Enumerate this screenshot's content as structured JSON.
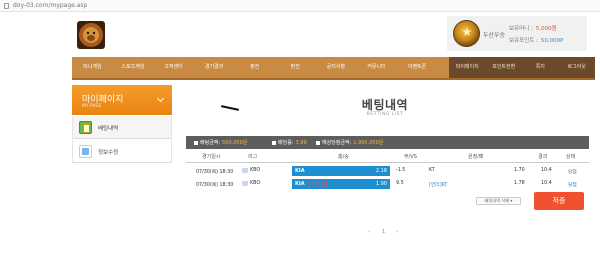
{
  "browser": {
    "url": "doy-03.com/mypage.asp"
  },
  "user_box": {
    "username": "두산우승",
    "money_label": "보유머니 :",
    "money_value": "5,000원",
    "point_label": "보유포인트 :",
    "point_value": "50,000P"
  },
  "nav": {
    "main": [
      "미니게임",
      "스포츠게임",
      "고객센터",
      "경기결과",
      "출전",
      "환전",
      "공지사항",
      "커뮤니티",
      "이벤트존"
    ],
    "sub": [
      "마이페이지",
      "포인트전환",
      "쪽지",
      "로그아웃"
    ]
  },
  "sidebar": {
    "title": "마이페이지",
    "subtitle": "MY PAGE",
    "items": [
      {
        "label": "베팅내역"
      },
      {
        "label": "정보수정"
      }
    ]
  },
  "page": {
    "title": "베팅내역",
    "subtitle": "BETTING LIST"
  },
  "summary": [
    {
      "label": "배팅금액:",
      "value": "500,000원"
    },
    {
      "label": "배당률:",
      "value": "3.99"
    },
    {
      "label": "예상당첨금액:",
      "value": "1,995,000원"
    }
  ],
  "table": {
    "headers": [
      "경기일시",
      "리그",
      "홈/승",
      "무/VS",
      "원정/패",
      "결과",
      "상태"
    ],
    "rows": [
      {
        "date": "07/30(목) 18:30",
        "league": "KBO",
        "home": "KIA",
        "home_note": "",
        "home_odds": "2.18",
        "vs": "-1.5",
        "away": "KT",
        "away_odds": "1.70",
        "score": "10:4",
        "status": "당첨"
      },
      {
        "date": "07/30(목) 18:30",
        "league": "KBO",
        "home": "KIA",
        "home_note": "[기아 승]",
        "home_odds": "1.90",
        "vs": "9.5",
        "away": "[언더]KT",
        "away_odds": "1.78",
        "score": "10:4",
        "status": "당첨"
      }
    ]
  },
  "buttons": {
    "cancel": "배팅내역 삭제 ▾",
    "confirm": "적중"
  },
  "pager": {
    "prev": "‹",
    "page": "1",
    "next": "›"
  }
}
